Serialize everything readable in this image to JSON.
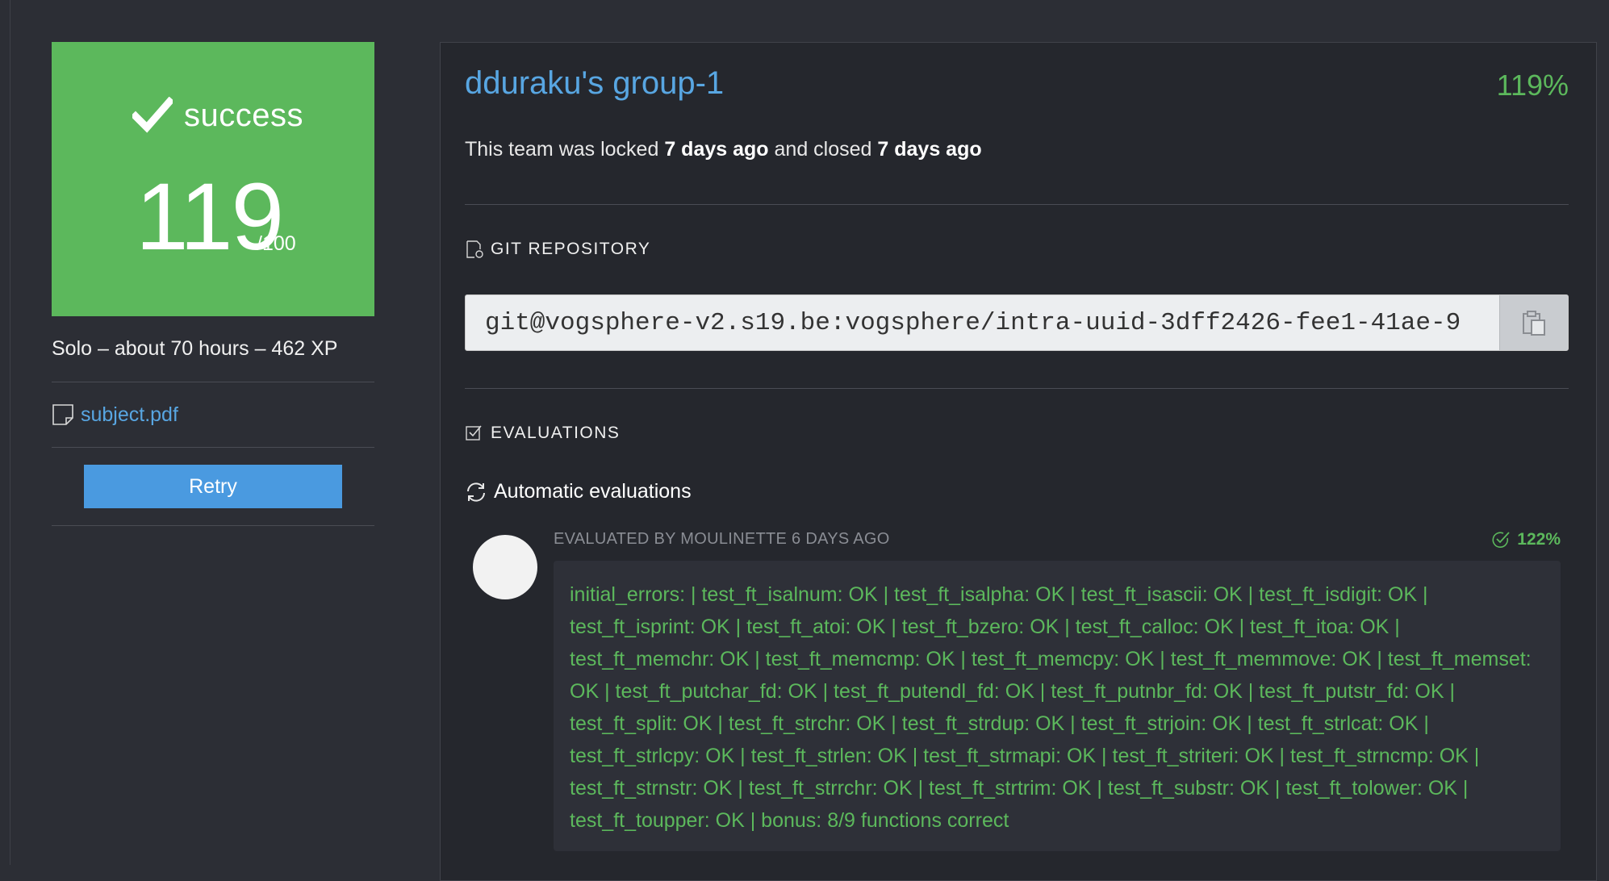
{
  "status": {
    "label": "success",
    "score": "119",
    "score_max": "/100",
    "meta": "Solo – about 70 hours – 462 XP",
    "subject_link": "subject.pdf",
    "retry_label": "Retry",
    "box_color": "#5cb85c"
  },
  "team": {
    "title": "dduraku's group-1",
    "percent": "119%",
    "lock_prefix": "This team was locked ",
    "locked_time": "7 days ago",
    "lock_middle": " and closed ",
    "closed_time": "7 days ago"
  },
  "git": {
    "heading": "GIT REPOSITORY",
    "url": "git@vogsphere-v2.s19.be:vogsphere/intra-uuid-3dff2426-fee1-41ae-9"
  },
  "evaluations": {
    "heading": "EVALUATIONS",
    "auto_title": "Automatic evaluations",
    "evaluator": "EVALUATED BY MOULINETTE 6 DAYS AGO",
    "score": "122%",
    "results": "initial_errors: | test_ft_isalnum: OK | test_ft_isalpha: OK | test_ft_isascii: OK | test_ft_isdigit: OK | test_ft_isprint: OK | test_ft_atoi: OK | test_ft_bzero: OK | test_ft_calloc: OK | test_ft_itoa: OK | test_ft_memchr: OK | test_ft_memcmp: OK | test_ft_memcpy: OK | test_ft_memmove: OK | test_ft_memset: OK | test_ft_putchar_fd: OK | test_ft_putendl_fd: OK | test_ft_putnbr_fd: OK | test_ft_putstr_fd: OK | test_ft_split: OK | test_ft_strchr: OK | test_ft_strdup: OK | test_ft_strjoin: OK | test_ft_strlcat: OK | test_ft_strlcpy: OK | test_ft_strlen: OK | test_ft_strmapi: OK | test_ft_striteri: OK | test_ft_strncmp: OK | test_ft_strnstr: OK | test_ft_strrchr: OK | test_ft_strtrim: OK | test_ft_substr: OK | test_ft_tolower: OK | test_ft_toupper: OK | bonus: 8/9 functions correct"
  },
  "icons": {
    "check": "check-icon",
    "document": "document-icon",
    "git": "git-file-icon",
    "evaluations": "checkbox-icon",
    "sync": "sync-icon",
    "copy": "clipboard-icon",
    "ok": "check-circle-icon"
  }
}
